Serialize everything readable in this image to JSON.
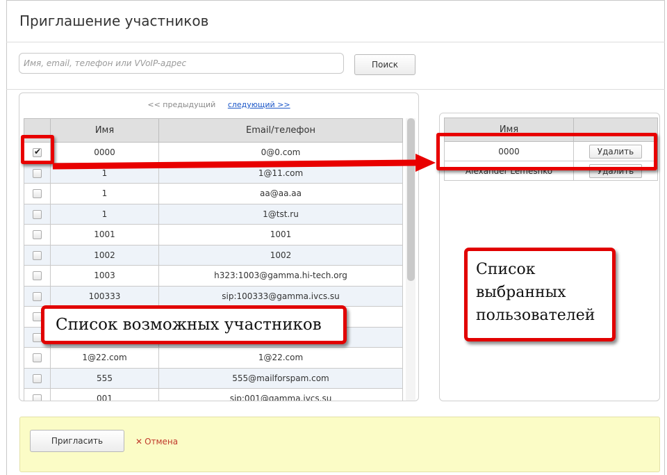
{
  "dialog": {
    "title": "Приглашение участников"
  },
  "search": {
    "placeholder": "Имя, email, телефон или VVoIP-адрес",
    "button": "Поиск"
  },
  "pager": {
    "prev": "<< предыдущий",
    "next": "следующий >>"
  },
  "candidates": {
    "columns": [
      "Имя",
      "Email/телефон"
    ],
    "rows": [
      {
        "checked": true,
        "name": "0000",
        "contact": "0@0.com"
      },
      {
        "checked": false,
        "name": "1",
        "contact": "1@11.com"
      },
      {
        "checked": false,
        "name": "1",
        "contact": "aa@aa.aa"
      },
      {
        "checked": false,
        "name": "1",
        "contact": "1@tst.ru"
      },
      {
        "checked": false,
        "name": "1001",
        "contact": "1001"
      },
      {
        "checked": false,
        "name": "1002",
        "contact": "1002"
      },
      {
        "checked": false,
        "name": "1003",
        "contact": "h323:1003@gamma.hi-tech.org"
      },
      {
        "checked": false,
        "name": "100333",
        "contact": "sip:100333@gamma.ivcs.su"
      },
      {
        "checked": false,
        "name": "",
        "contact": ""
      },
      {
        "checked": false,
        "name": "",
        "contact": ""
      },
      {
        "checked": false,
        "name": "1@22.com",
        "contact": "1@22.com"
      },
      {
        "checked": false,
        "name": "555",
        "contact": "555@mailforspam.com"
      },
      {
        "checked": false,
        "name": "001",
        "contact": "sip:001@gamma.ivcs.su"
      }
    ]
  },
  "selected": {
    "columns": [
      "Имя",
      ""
    ],
    "delete_label": "Удалить",
    "rows": [
      {
        "name": "0000"
      },
      {
        "name": "Alexander Lemeshko"
      }
    ]
  },
  "footer": {
    "invite": "Пригласить",
    "cancel": "Отмена",
    "cancel_icon": "✕"
  },
  "annotations": {
    "left_callout": "Список возможных участников",
    "right_callout_lines": [
      "Список",
      "выбранных",
      "пользователей"
    ],
    "color": "#e80000"
  }
}
